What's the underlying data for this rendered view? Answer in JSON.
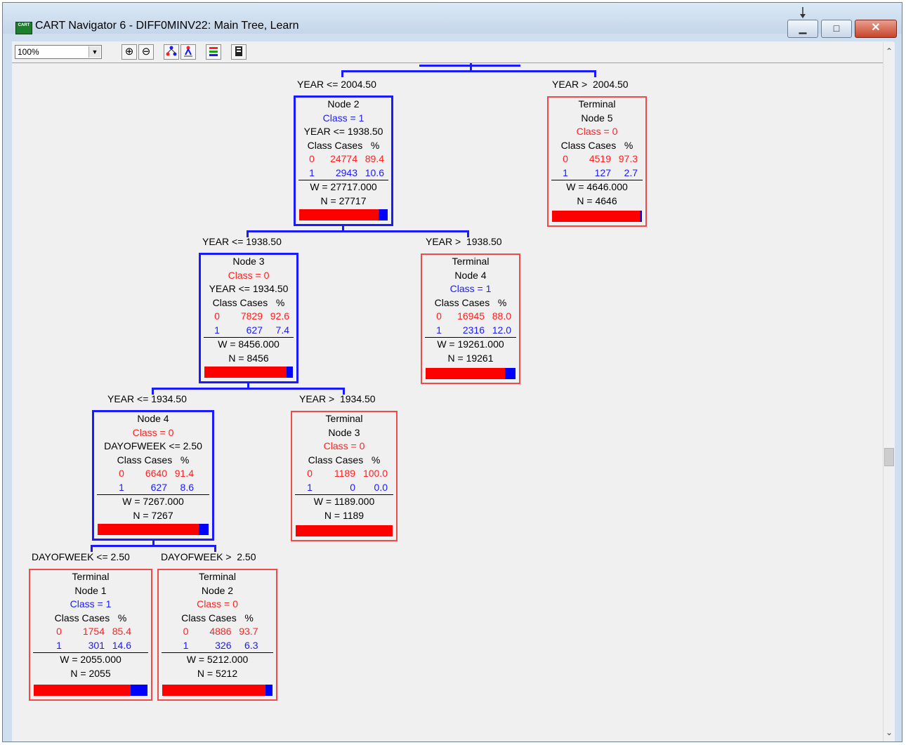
{
  "window": {
    "title": "CART Navigator 6 - DIFF0MINV22: Main Tree, Learn",
    "app_icon_text": "CART"
  },
  "toolbar": {
    "zoom": "100%"
  },
  "split_labels": {
    "root_left": "YEAR <= 2004.50",
    "root_right": "YEAR >  2004.50",
    "n2_left": "YEAR <= 1938.50",
    "n2_right": "YEAR >  1938.50",
    "n3_left": "YEAR <= 1934.50",
    "n3_right": "YEAR >  1934.50",
    "n4_left": "DAYOFWEEK <= 2.50",
    "n4_right": "DAYOFWEEK >  2.50"
  },
  "nodes": {
    "node2": {
      "title": "Node 2",
      "class_label": "Class = 1",
      "split": "YEAR <= 1938.50",
      "header": "Class Cases   %",
      "row0": {
        "cls": "0",
        "cases": "24774",
        "pct": "89.4"
      },
      "row1": {
        "cls": "1",
        "cases": "2943",
        "pct": "10.6"
      },
      "w": "W = 27717.000",
      "n": "N = 27717",
      "share1": 0.106
    },
    "term5": {
      "term": "Terminal",
      "title": "Node 5",
      "class_label": "Class = 0",
      "header": "Class Cases   %",
      "row0": {
        "cls": "0",
        "cases": "4519",
        "pct": "97.3"
      },
      "row1": {
        "cls": "1",
        "cases": "127",
        "pct": "2.7"
      },
      "w": "W = 4646.000",
      "n": "N = 4646",
      "share1": 0.027
    },
    "node3": {
      "title": "Node 3",
      "class_label": "Class = 0",
      "split": "YEAR <= 1934.50",
      "header": "Class Cases   %",
      "row0": {
        "cls": "0",
        "cases": "7829",
        "pct": "92.6"
      },
      "row1": {
        "cls": "1",
        "cases": "627",
        "pct": "7.4"
      },
      "w": "W = 8456.000",
      "n": "N = 8456",
      "share1": 0.074
    },
    "term4": {
      "term": "Terminal",
      "title": "Node 4",
      "class_label": "Class = 1",
      "header": "Class Cases   %",
      "row0": {
        "cls": "0",
        "cases": "16945",
        "pct": "88.0"
      },
      "row1": {
        "cls": "1",
        "cases": "2316",
        "pct": "12.0"
      },
      "w": "W = 19261.000",
      "n": "N = 19261",
      "share1": 0.12
    },
    "node4": {
      "title": "Node 4",
      "class_label": "Class = 0",
      "split": "DAYOFWEEK <= 2.50",
      "header": "Class Cases   %",
      "row0": {
        "cls": "0",
        "cases": "6640",
        "pct": "91.4"
      },
      "row1": {
        "cls": "1",
        "cases": "627",
        "pct": "8.6"
      },
      "w": "W = 7267.000",
      "n": "N = 7267",
      "share1": 0.086
    },
    "term3": {
      "term": "Terminal",
      "title": "Node 3",
      "class_label": "Class = 0",
      "header": "Class Cases   %",
      "row0": {
        "cls": "0",
        "cases": "1189",
        "pct": "100.0"
      },
      "row1": {
        "cls": "1",
        "cases": "0",
        "pct": "0.0"
      },
      "w": "W = 1189.000",
      "n": "N = 1189",
      "share1": 0.0
    },
    "term1": {
      "term": "Terminal",
      "title": "Node 1",
      "class_label": "Class = 1",
      "header": "Class Cases   %",
      "row0": {
        "cls": "0",
        "cases": "1754",
        "pct": "85.4"
      },
      "row1": {
        "cls": "1",
        "cases": "301",
        "pct": "14.6"
      },
      "w": "W = 2055.000",
      "n": "N = 2055",
      "share1": 0.146
    },
    "term2": {
      "term": "Terminal",
      "title": "Node 2",
      "class_label": "Class = 0",
      "header": "Class Cases   %",
      "row0": {
        "cls": "0",
        "cases": "4886",
        "pct": "93.7"
      },
      "row1": {
        "cls": "1",
        "cases": "326",
        "pct": "6.3"
      },
      "w": "W = 5212.000",
      "n": "N = 5212",
      "share1": 0.063
    }
  },
  "colors": {
    "class0": "#ff2020",
    "class1": "#1a1aff",
    "split_border": "#1a1aff",
    "terminal_border": "#f04a4a"
  }
}
